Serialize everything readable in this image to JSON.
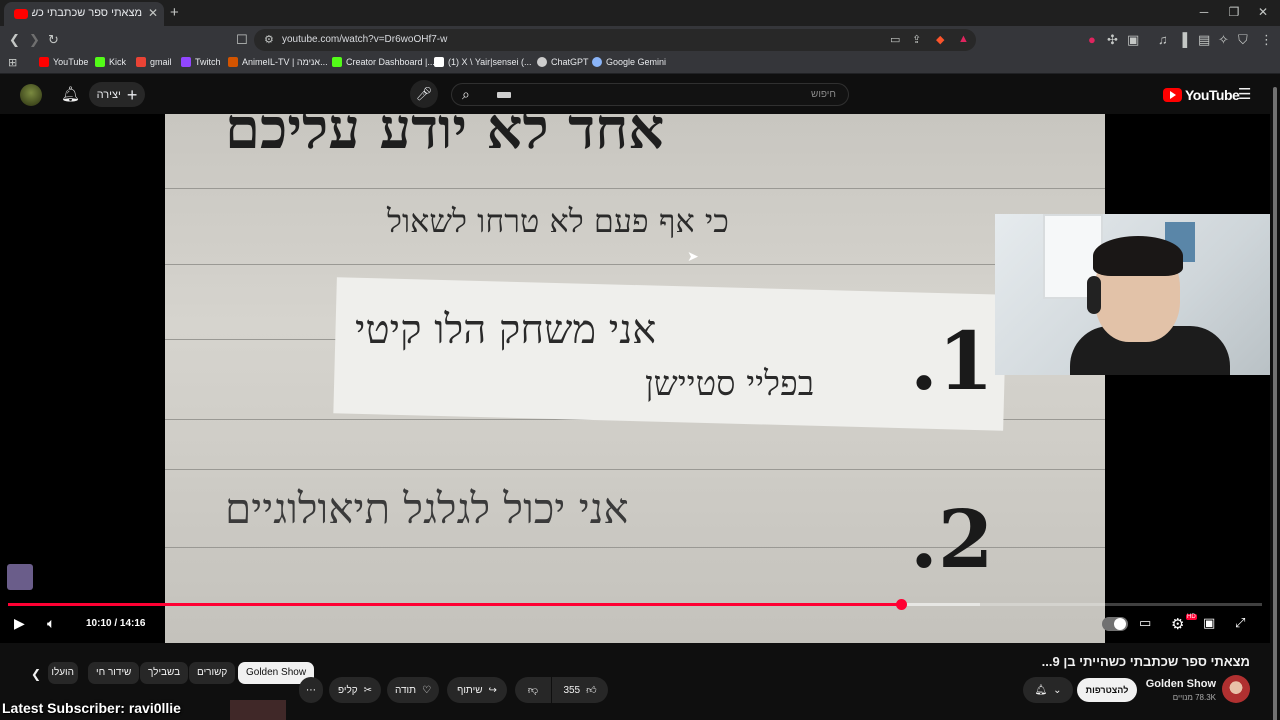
{
  "browser": {
    "tab_title": "מצאתי ספר שכתבתי כשהייתי בן",
    "url": "youtube.com/watch?v=Dr6woOHf7-w",
    "bookmarks": [
      {
        "label": "YouTube",
        "color": "#ff0000"
      },
      {
        "label": "Kick",
        "color": "#53fc18"
      },
      {
        "label": "gmail",
        "color": "#ea4335"
      },
      {
        "label": "Twitch",
        "color": "#9146ff"
      },
      {
        "label": "AnimeIL-TV | אנימה...",
        "color": "#d35400"
      },
      {
        "label": "Creator Dashboard |...",
        "color": "#53fc18"
      },
      {
        "label": "(1) X \\ Yair|sensei (...",
        "color": "#ffffff"
      },
      {
        "label": "ChatGPT",
        "color": "#cccccc"
      },
      {
        "label": "Google Gemini",
        "color": "#8ab4f8"
      }
    ]
  },
  "youtube": {
    "create_label": "יצירה",
    "search_placeholder": "חיפוש",
    "logo_text": "YouTube"
  },
  "player": {
    "frame_text": {
      "top": "אחד לא יודע עליכם",
      "line1": "כי אף פעם לא טרחו לשאול",
      "item1_num": "1.",
      "item1": "אני משחק הלו קיטי",
      "item1b": "בפליי סטיישן",
      "item2_num": "2.",
      "item2": "אני יכול לגלגל תיאולוגיים"
    },
    "time_current": "10:10",
    "time_separator": " / ",
    "time_total": "14:16",
    "progress_played_fraction": 0.712,
    "progress_buffered_fraction": 0.775,
    "hd_badge": "HD"
  },
  "video": {
    "title": "מצאתי ספר שכתבתי כשהייתי בן 9...",
    "channel_name": "Golden Show",
    "subscribers": "78.3K מנויים",
    "join_label": "להצטרפות",
    "likes": "355",
    "share_label": "שיתוף",
    "thanks_label": "תודה",
    "clip_label": "קליפ",
    "chips": [
      "Golden Show",
      "קשורים",
      "בשבילך",
      "שידור חי",
      "הועלו"
    ]
  },
  "overlay": {
    "latest_subscriber": "Latest Subscriber: ravi0llie"
  }
}
